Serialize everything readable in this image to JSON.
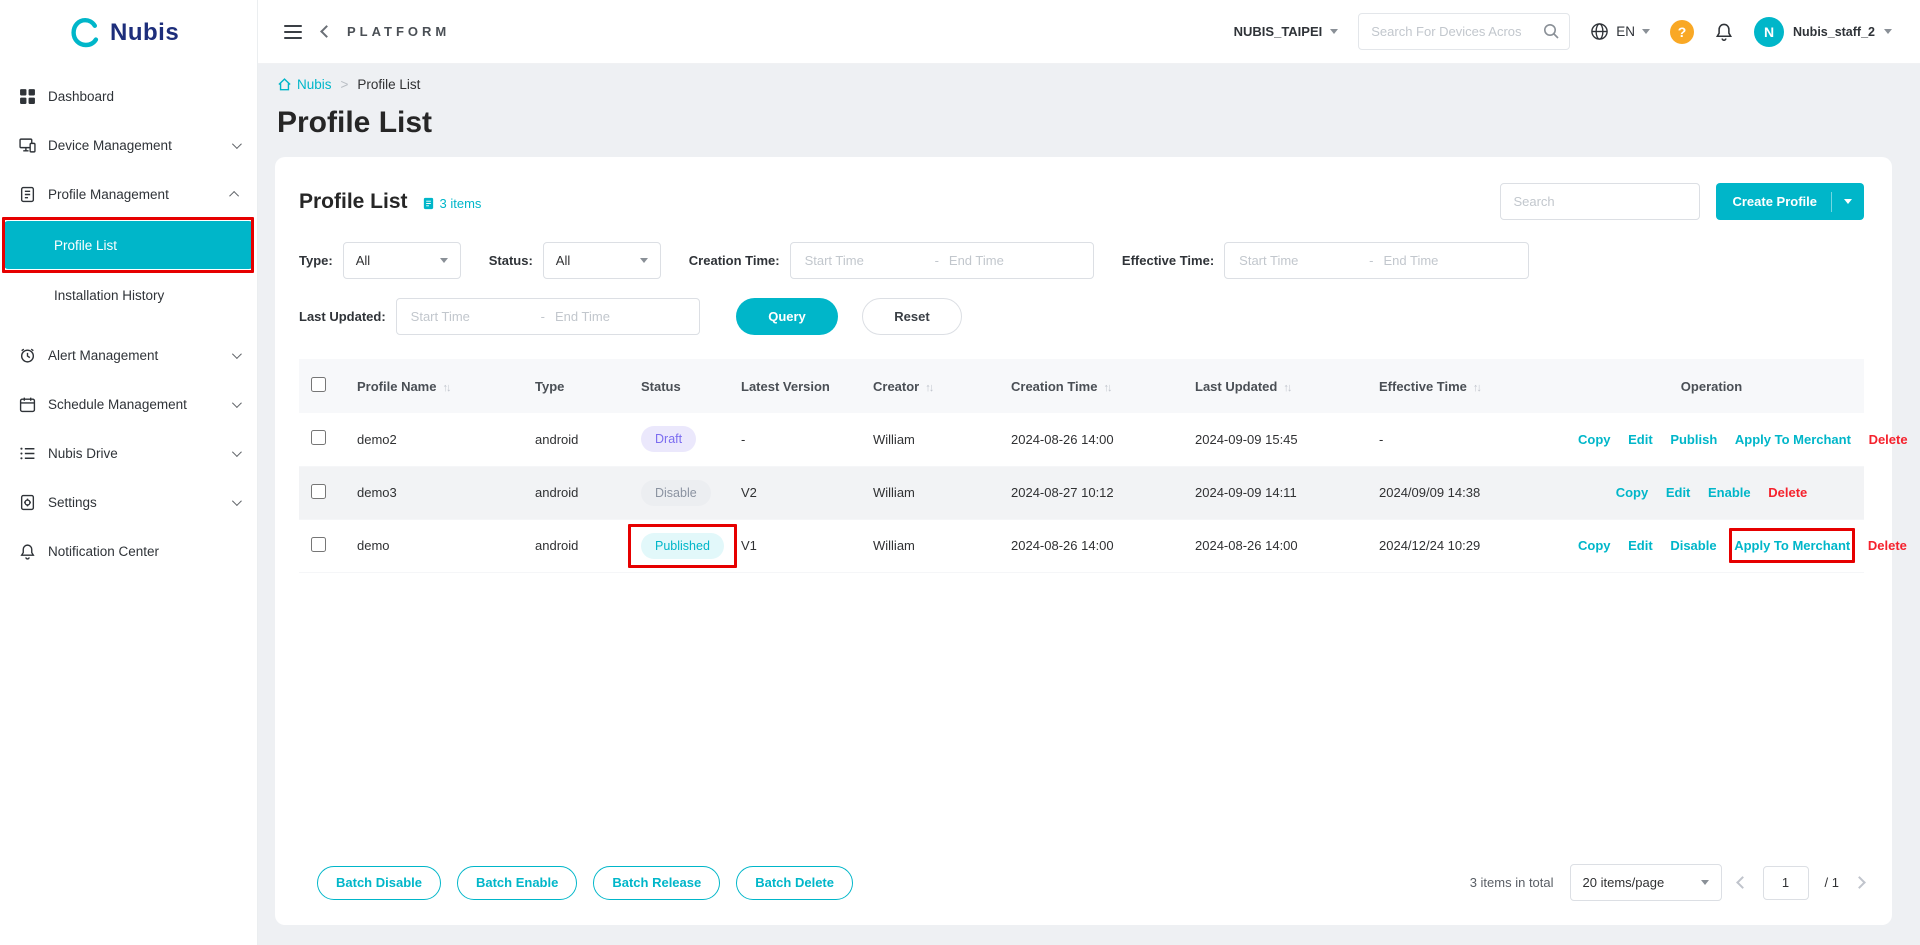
{
  "topbar": {
    "platform": "PLATFORM",
    "org": "NUBIS_TAIPEI",
    "search_placeholder": "Search For Devices Acros",
    "language": "EN",
    "help_glyph": "?",
    "avatar_letter": "N",
    "username": "Nubis_staff_2"
  },
  "sidebar": {
    "logo_text": "Nubis",
    "items": [
      {
        "label": "Dashboard"
      },
      {
        "label": "Device Management"
      },
      {
        "label": "Profile Management"
      },
      {
        "label": "Alert Management"
      },
      {
        "label": "Schedule Management"
      },
      {
        "label": "Nubis Drive"
      },
      {
        "label": "Settings"
      },
      {
        "label": "Notification Center"
      }
    ],
    "profile_children": [
      {
        "label": "Profile List"
      },
      {
        "label": "Installation History"
      }
    ]
  },
  "breadcrumb": {
    "home": "Nubis",
    "separator": ">",
    "current": "Profile List"
  },
  "page": {
    "title": "Profile List"
  },
  "panel": {
    "title": "Profile List",
    "count": "3 items",
    "search_placeholder": "Search",
    "create_button": "Create Profile",
    "filters": {
      "type_label": "Type:",
      "type_value": "All",
      "status_label": "Status:",
      "status_value": "All",
      "creation_time_label": "Creation Time:",
      "effective_time_label": "Effective Time:",
      "last_updated_label": "Last Updated:",
      "start_placeholder": "Start Time",
      "end_placeholder": "End Time",
      "range_separator": "-",
      "query": "Query",
      "reset": "Reset"
    },
    "table": {
      "columns": [
        {
          "label": "Profile Name"
        },
        {
          "label": "Type"
        },
        {
          "label": "Status"
        },
        {
          "label": "Latest Version"
        },
        {
          "label": "Creator"
        },
        {
          "label": "Creation Time"
        },
        {
          "label": "Last Updated"
        },
        {
          "label": "Effective Time"
        },
        {
          "label": "Operation"
        }
      ],
      "rows": [
        {
          "profile_name": "demo2",
          "type": "android",
          "status": "Draft",
          "latest_version": "-",
          "creator": "William",
          "creation_time": "2024-08-26 14:00",
          "last_updated": "2024-09-09 15:45",
          "effective_time": "-",
          "op_copy": "Copy",
          "op_edit": "Edit",
          "op_publish": "Publish",
          "op_apply": "Apply To Merchant",
          "op_delete": "Delete"
        },
        {
          "profile_name": "demo3",
          "type": "android",
          "status": "Disable",
          "latest_version": "V2",
          "creator": "William",
          "creation_time": "2024-08-27 10:12",
          "last_updated": "2024-09-09 14:11",
          "effective_time": "2024/09/09 14:38",
          "op_copy": "Copy",
          "op_edit": "Edit",
          "op_enable": "Enable",
          "op_delete": "Delete"
        },
        {
          "profile_name": "demo",
          "type": "android",
          "status": "Published",
          "latest_version": "V1",
          "creator": "William",
          "creation_time": "2024-08-26 14:00",
          "last_updated": "2024-08-26 14:00",
          "effective_time": "2024/12/24 10:29",
          "op_copy": "Copy",
          "op_edit": "Edit",
          "op_disable": "Disable",
          "op_apply": "Apply To Merchant",
          "op_delete": "Delete"
        }
      ]
    },
    "footer": {
      "batch_disable": "Batch Disable",
      "batch_enable": "Batch Enable",
      "batch_release": "Batch Release",
      "batch_delete": "Batch Delete",
      "total": "3 items in total",
      "page_size": "20 items/page",
      "page_value": "1",
      "page_total": "/ 1"
    }
  },
  "colors": {
    "primary": "#00b6c9",
    "danger": "#f5222d",
    "annotation": "#e60000",
    "badge_draft_bg": "#ebe8fc",
    "badge_draft_text": "#7b6cf0",
    "badge_disable_bg": "#eceef1",
    "badge_disable_text": "#8b93a1",
    "badge_published_bg": "#e2f8fa",
    "badge_published_text": "#00b6c9"
  }
}
